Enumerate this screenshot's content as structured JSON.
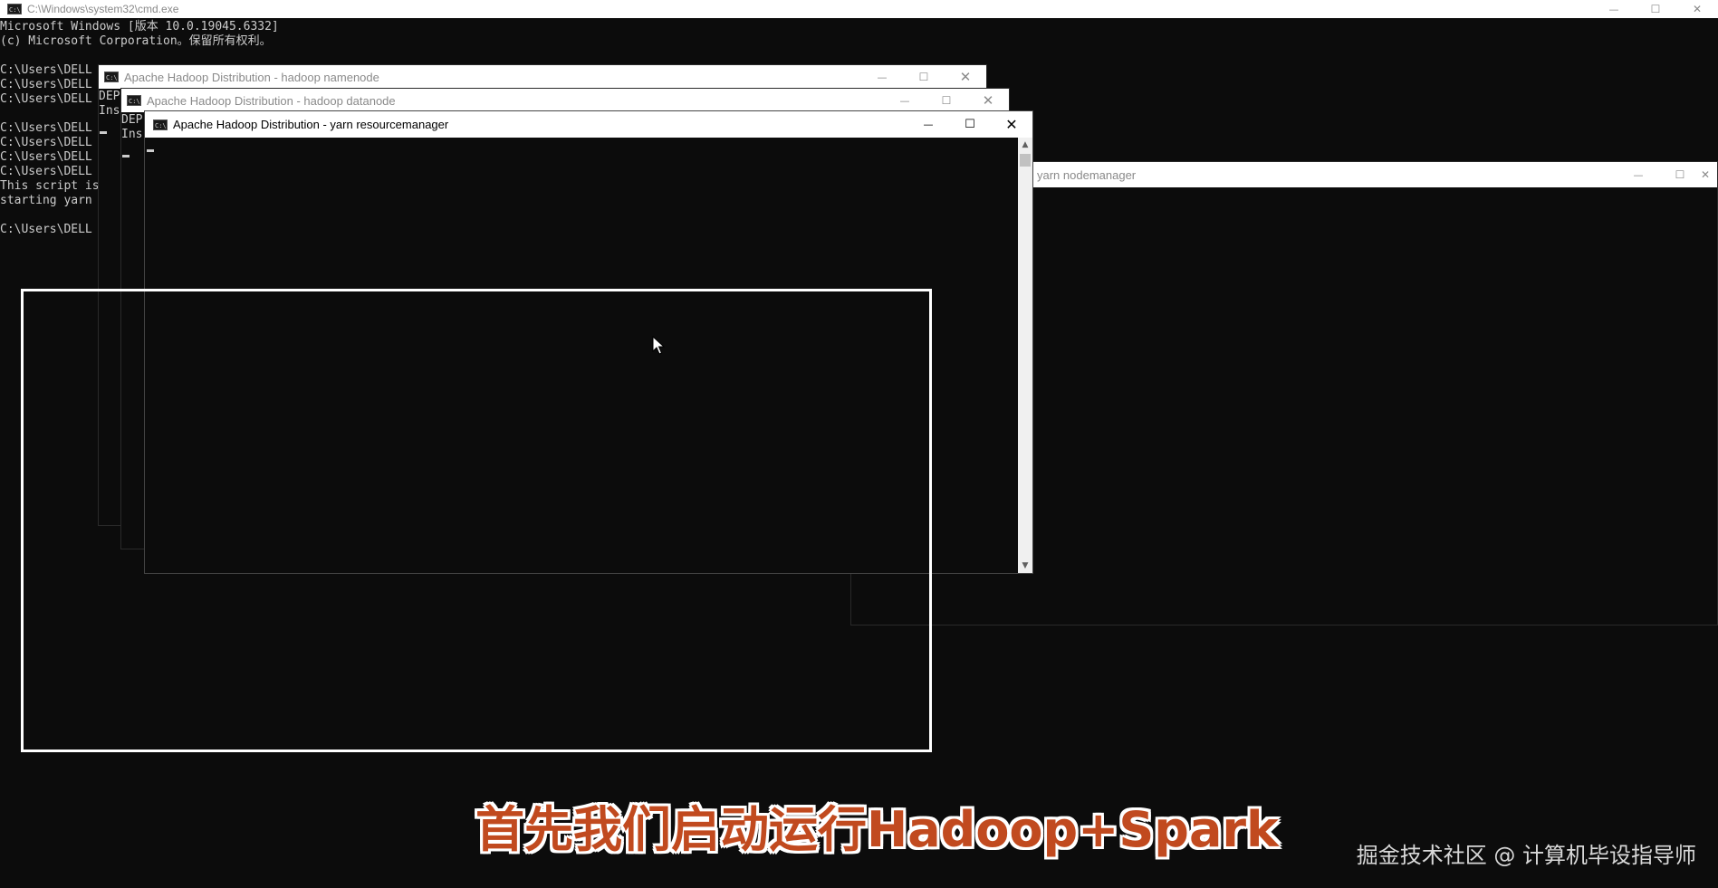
{
  "cmd_window": {
    "title": "C:\\Windows\\system32\\cmd.exe",
    "lines": [
      "Microsoft Windows [版本 10.0.19045.6332]",
      "(c) Microsoft Corporation。保留所有权利。",
      "",
      "C:\\Users\\DELL",
      "C:\\Users\\DELL",
      "C:\\Users\\DELL",
      "",
      "C:\\Users\\DELL",
      "C:\\Users\\DELL",
      "C:\\Users\\DELL",
      "C:\\Users\\DELL",
      "This script is",
      "starting yarn",
      "",
      "C:\\Users\\DELL"
    ]
  },
  "namenode_window": {
    "title": "Apache Hadoop Distribution - hadoop   namenode",
    "lines": [
      "DEP",
      "Ins"
    ]
  },
  "datanode_window": {
    "title": "Apache Hadoop Distribution - hadoop   datanode",
    "lines": [
      "DEP",
      "Ins"
    ]
  },
  "resourcemanager_window": {
    "title": "Apache Hadoop Distribution - yarn   resourcemanager"
  },
  "nodemanager_window": {
    "title": "yarn   nodemanager"
  },
  "window_controls": {
    "minimize": "—",
    "maximize": "☐",
    "close": "✕"
  },
  "scrollbar": {
    "up_arrow": "▲",
    "down_arrow": "▼"
  },
  "subtitle": "首先我们启动运行Hadoop+Spark",
  "watermark": "掘金技术社区 @ 计算机毕设指导师"
}
